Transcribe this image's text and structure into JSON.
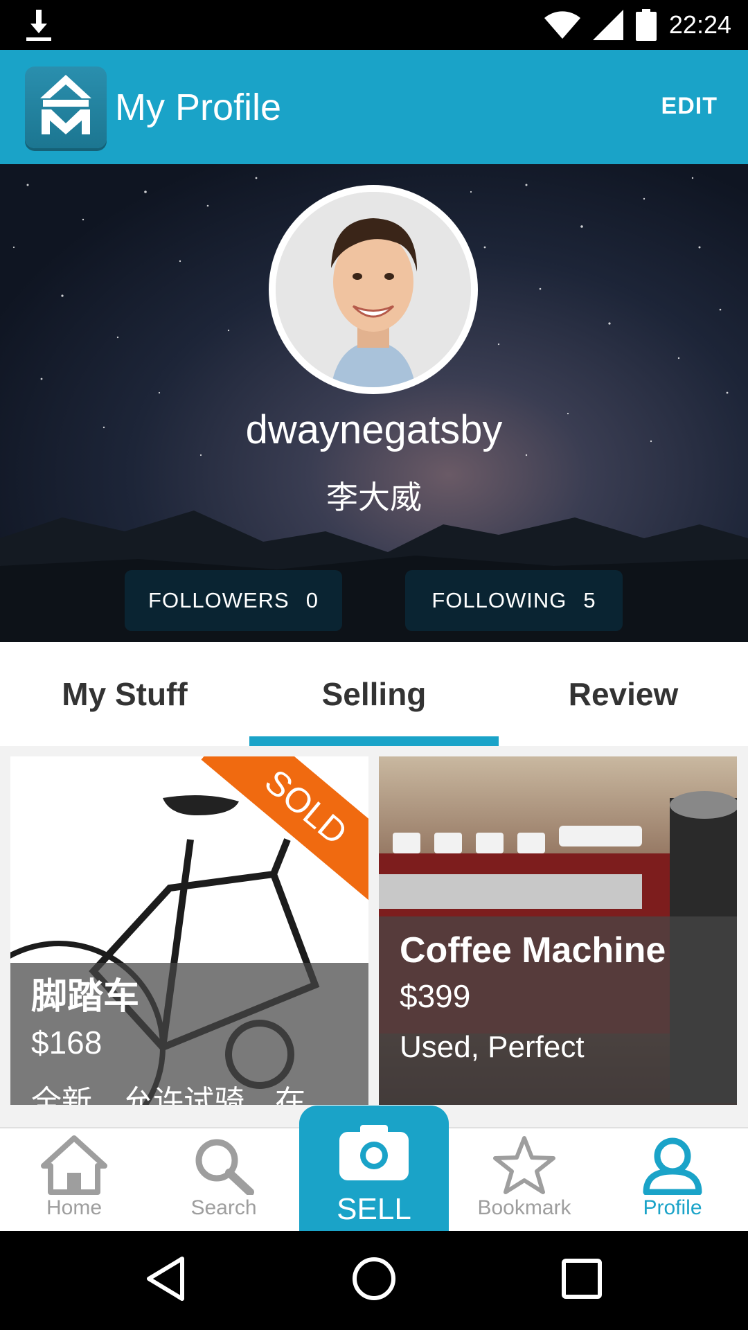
{
  "status_bar": {
    "time": "22:24"
  },
  "app_bar": {
    "title": "My Profile",
    "edit_label": "EDIT"
  },
  "profile": {
    "username": "dwaynegatsby",
    "real_name": "李大威",
    "followers_label": "FOLLOWERS",
    "followers_count": "0",
    "following_label": "FOLLOWING",
    "following_count": "5"
  },
  "tabs": [
    {
      "label": "My Stuff",
      "active": false
    },
    {
      "label": "Selling",
      "active": true
    },
    {
      "label": "Review",
      "active": false
    }
  ],
  "listings": [
    {
      "title": "脚踏车",
      "price": "$168",
      "description": "全新，允许试骑，在",
      "badge": "SOLD"
    },
    {
      "title": "Coffee Machine",
      "price": "$399",
      "description": "Used, Perfect"
    }
  ],
  "bottom_nav": {
    "home": "Home",
    "search": "Search",
    "sell": "SELL",
    "bookmark": "Bookmark",
    "profile": "Profile"
  },
  "colors": {
    "accent": "#1aa3c8",
    "sold_badge": "#f06a10",
    "inactive": "#9e9e9e"
  },
  "icons": [
    "download-icon",
    "wifi-icon",
    "signal-icon",
    "battery-icon",
    "app-logo",
    "home-icon",
    "search-icon",
    "camera-icon",
    "star-icon",
    "person-icon",
    "back-icon",
    "home-circle-icon",
    "recents-icon"
  ]
}
